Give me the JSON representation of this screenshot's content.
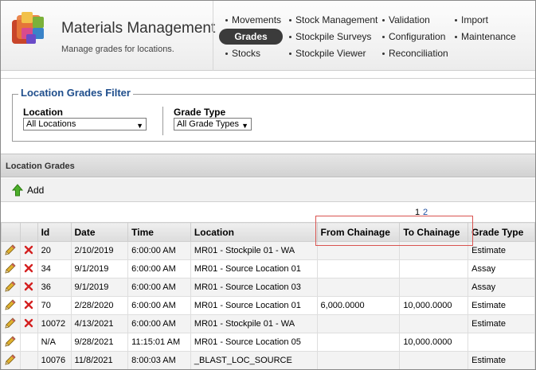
{
  "header": {
    "title": "Materials Management",
    "subtitle": "Manage grades for locations.",
    "nav": {
      "col1": [
        "Movements",
        "Grades",
        "Stocks"
      ],
      "col2": [
        "Stock Management",
        "Stockpile Surveys",
        "Stockpile Viewer"
      ],
      "col3": [
        "Validation",
        "Configuration",
        "Reconciliation"
      ],
      "col4": [
        "Import",
        "Maintenance"
      ]
    },
    "active_nav": "Grades"
  },
  "filter": {
    "legend": "Location Grades Filter",
    "location_label": "Location",
    "location_value": "All Locations",
    "grade_type_label": "Grade Type",
    "grade_type_value": "All Grade Types"
  },
  "section": {
    "title": "Location Grades",
    "add_label": "Add"
  },
  "pager": {
    "current": "1",
    "next": "2"
  },
  "table": {
    "columns": [
      "Id",
      "Date",
      "Time",
      "Location",
      "From Chainage",
      "To Chainage",
      "Grade Type"
    ],
    "rows": [
      {
        "deletable": true,
        "id": "20",
        "date": "2/10/2019",
        "time": "6:00:00 AM",
        "location": "MR01 - Stockpile 01 - WA",
        "from": "",
        "to": "",
        "grade_type": "Estimate"
      },
      {
        "deletable": true,
        "id": "34",
        "date": "9/1/2019",
        "time": "6:00:00 AM",
        "location": "MR01 - Source Location 01",
        "from": "",
        "to": "",
        "grade_type": "Assay"
      },
      {
        "deletable": true,
        "id": "36",
        "date": "9/1/2019",
        "time": "6:00:00 AM",
        "location": "MR01 - Source Location 03",
        "from": "",
        "to": "",
        "grade_type": "Assay"
      },
      {
        "deletable": true,
        "id": "70",
        "date": "2/28/2020",
        "time": "6:00:00 AM",
        "location": "MR01 - Source Location 01",
        "from": "6,000.0000",
        "to": "10,000.0000",
        "grade_type": "Estimate"
      },
      {
        "deletable": true,
        "id": "10072",
        "date": "4/13/2021",
        "time": "6:00:00 AM",
        "location": "MR01 - Stockpile 01 - WA",
        "from": "",
        "to": "",
        "grade_type": "Estimate"
      },
      {
        "deletable": false,
        "id": "N/A",
        "date": "9/28/2021",
        "time": "11:15:01 AM",
        "location": "MR01 - Source Location 05",
        "from": "",
        "to": "10,000.0000",
        "grade_type": ""
      },
      {
        "deletable": false,
        "id": "10076",
        "date": "11/8/2021",
        "time": "8:00:03 AM",
        "location": "_BLAST_LOC_SOURCE",
        "from": "",
        "to": "",
        "grade_type": "Estimate"
      }
    ]
  }
}
